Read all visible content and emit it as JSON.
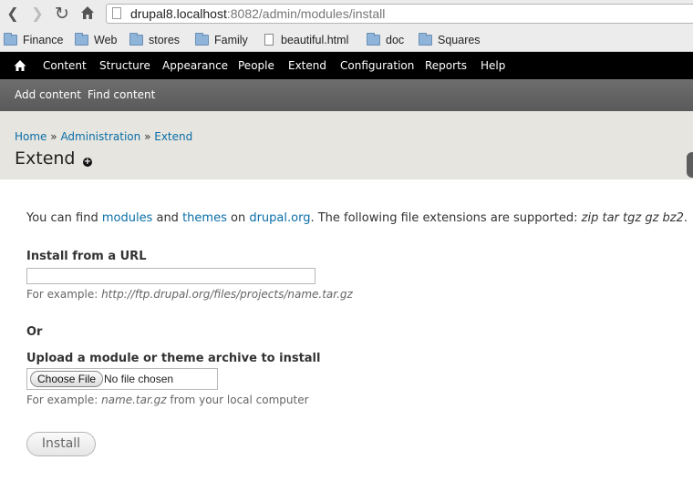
{
  "browser": {
    "url_host": "drupal8.localhost",
    "url_rest": ":8082/admin/modules/install",
    "bookmarks": [
      {
        "label": "Finance",
        "icon": "folder-icon"
      },
      {
        "label": "Web",
        "icon": "folder-icon"
      },
      {
        "label": "stores",
        "icon": "folder-icon"
      },
      {
        "label": "Family",
        "icon": "folder-icon"
      },
      {
        "label": "beautiful.html",
        "icon": "page-icon"
      },
      {
        "label": "doc",
        "icon": "folder-icon"
      },
      {
        "label": "Squares",
        "icon": "folder-icon"
      }
    ]
  },
  "toolbar": {
    "items": [
      "Content",
      "Structure",
      "Appearance",
      "People",
      "Extend",
      "Configuration",
      "Reports",
      "Help"
    ],
    "shortcuts": [
      "Add content",
      "Find content"
    ]
  },
  "header": {
    "breadcrumb": [
      "Home",
      "Administration",
      "Extend"
    ],
    "separator": "»",
    "title": "Extend"
  },
  "content": {
    "intro_prefix": "You can find ",
    "link_modules": "modules",
    "and": " and ",
    "link_themes": "themes",
    "on": " on ",
    "link_drupal": "drupal.org",
    "intro_suffix": ". The following file extensions are supported: ",
    "extensions": "zip tar tgz gz bz2",
    "intro_end": ".",
    "url_label": "Install from a URL",
    "url_value": "",
    "url_hint_prefix": "For example: ",
    "url_hint_example": "http://ftp.drupal.org/files/projects/name.tar.gz",
    "or_label": "Or",
    "upload_label": "Upload a module or theme archive to install",
    "choose_file": "Choose File",
    "no_file": "No file chosen",
    "upload_hint_prefix": "For example: ",
    "upload_hint_example": "name.tar.gz",
    "upload_hint_suffix": " from your local computer",
    "install_button": "Install"
  },
  "colors": {
    "link": "#0a6ea8",
    "toolbar_bg": "#000000",
    "shortcut_bg": "#5f5f5f",
    "header_bg": "#e6e5df"
  }
}
